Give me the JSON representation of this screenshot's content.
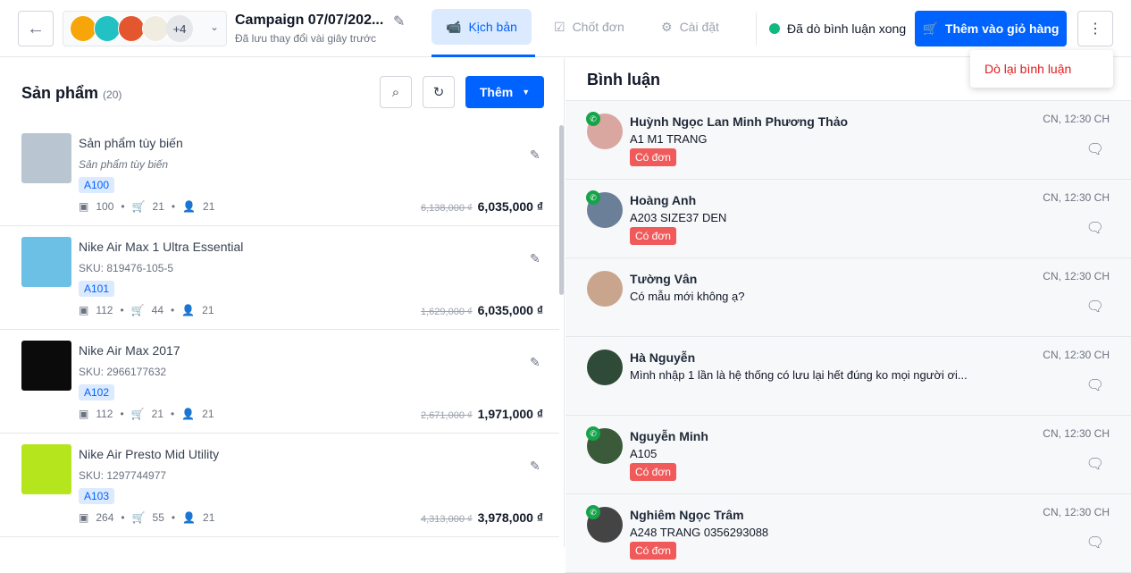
{
  "header": {
    "campaign_title": "Campaign 07/07/202...",
    "saved_status": "Đã lưu thay đổi vài giây trước",
    "more_pages": "+4",
    "tabs": [
      {
        "label": "Kịch bản",
        "active": true
      },
      {
        "label": "Chốt đơn"
      },
      {
        "label": "Cài đặt"
      }
    ],
    "scan_status": "Đã dò bình luận xong",
    "add_to_cart": "Thêm vào giỏ hàng",
    "menu_item": "Dò lại bình luận"
  },
  "products": {
    "title": "Sản phẩm",
    "count": "(20)",
    "add_button": "Thêm",
    "items": [
      {
        "name": "Sản phẩm tùy biến",
        "sku": "Sản phẩm tùy biến",
        "tag": "A100",
        "stock": "100",
        "cart": "21",
        "buyers": "21",
        "old_price": "6,138,000 ₫",
        "price": "6,035,000 ₫"
      },
      {
        "name": "Nike Air Max 1 Ultra Essential",
        "sku": "SKU: 819476-105-5",
        "tag": "A101",
        "stock": "112",
        "cart": "44",
        "buyers": "21",
        "old_price": "1,629,000 ₫",
        "price": "6,035,000 ₫"
      },
      {
        "name": "Nike Air Max 2017",
        "sku": "SKU: 2966177632",
        "tag": "A102",
        "stock": "112",
        "cart": "21",
        "buyers": "21",
        "old_price": "2,671,000 ₫",
        "price": "1,971,000 ₫"
      },
      {
        "name": "Nike Air Presto Mid Utility",
        "sku": "SKU: 1297744977",
        "tag": "A103",
        "stock": "264",
        "cart": "55",
        "buyers": "21",
        "old_price": "4,313,000 ₫",
        "price": "3,978,000 ₫"
      }
    ]
  },
  "comments": {
    "title": "Bình luận",
    "items": [
      {
        "name": "Huỳnh Ngọc Lan Minh Phương Thảo",
        "text": "A1 M1 TRANG",
        "badge": "Có đơn",
        "time": "CN, 12:30 CH"
      },
      {
        "name": "Hoàng Anh",
        "text": "A203 SIZE37 DEN",
        "badge": "Có đơn",
        "time": "CN, 12:30 CH"
      },
      {
        "name": "Tường Vân",
        "text": "Có mẫu mới không ạ?",
        "time": "CN, 12:30 CH"
      },
      {
        "name": "Hà Nguyễn",
        "text": "Mình nhập 1 lần là hệ thống có lưu lại hết đúng ko mọi người ơi...",
        "time": "CN, 12:30 CH"
      },
      {
        "name": "Nguyễn Minh",
        "text": "A105",
        "badge": "Có đơn",
        "time": "CN, 12:30 CH"
      },
      {
        "name": "Nghiêm Ngọc Trâm",
        "text": "A248 TRANG 0356293088",
        "badge": "Có đơn",
        "time": "CN, 12:30 CH"
      }
    ]
  }
}
